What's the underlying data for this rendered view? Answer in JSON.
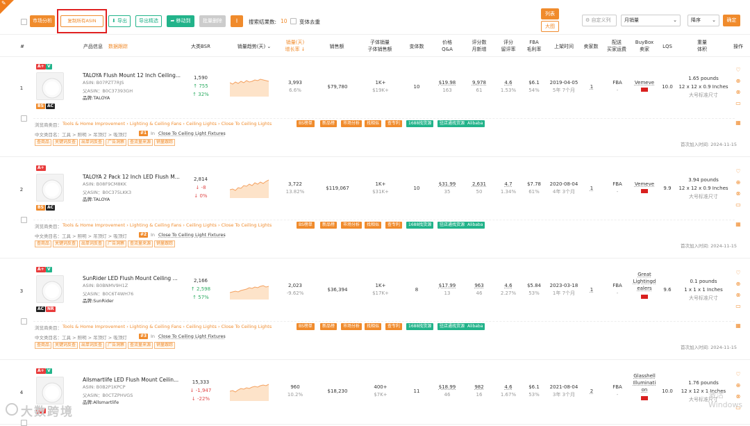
{
  "toolbar": {
    "market_btn": "市场分析",
    "copy_btn": "复制所有ASIN",
    "export_btn": "导出",
    "export_sel_btn": "导出精选",
    "move_btn": "移动到",
    "batch_del_btn": "批量删除",
    "more_btn": "⋮",
    "results_label": "搜索结果数:",
    "results_value": "10",
    "dedupe_label": "变体去重",
    "list_view_btn": "列表",
    "grid_view_btn": "大图",
    "custom_cols_btn": "自定义列",
    "sort_field": "月销量",
    "sort_order": "降序",
    "confirm_btn": "确定"
  },
  "header": {
    "col_num": "#",
    "col_product": "产品信息",
    "col_product_link": "数据跟踪",
    "col_bsr": "大类BSR",
    "col_trend": "销量趋势(天)",
    "col_sales_1": "销量(天)",
    "col_sales_2": "增长率",
    "col_revenue": "销售额",
    "col_child_1": "子体销量",
    "col_child_2": "子体销售额",
    "col_variants": "变体数",
    "col_price_1": "价格",
    "col_price_2": "Q&A",
    "col_reviews_1": "评分数",
    "col_reviews_2": "月新增",
    "col_rating_1": "评分",
    "col_rating_2": "留评率",
    "col_fba_1": "FBA",
    "col_fba_2": "毛利率",
    "col_listed": "上架时间",
    "col_sellers": "卖家数",
    "col_ship_1": "配送",
    "col_ship_2": "买家运费",
    "col_buybox_1": "BuyBox",
    "col_buybox_2": "卖家",
    "col_lqs": "LQS",
    "col_weight_1": "重量",
    "col_weight_2": "体积",
    "col_ops": "操作"
  },
  "rows": [
    {
      "index": "1",
      "title": "TALOYA Flush Mount 12 Inch Ceiling...",
      "asin": "ASIN: B07PZT7RJS",
      "parent": "父ASIN：B0C37393GH",
      "brand": "品牌:TALOYA",
      "badges_top": [
        "A+",
        "V"
      ],
      "badges_bottom": [
        "BS",
        "AC"
      ],
      "bsr": "1,590",
      "bsr_change": "↑ 755",
      "bsr_pct": "↑ 32%",
      "bsr_dir": "up",
      "sales": "3,993",
      "growth": "6.6%",
      "revenue": "$79,780",
      "child_sales": "1K+",
      "child_revenue": "$19K+",
      "variants": "10",
      "price": "$19.98",
      "qa": "163",
      "reviews": "9,978",
      "new_reviews": "61",
      "rating": "4.6",
      "review_rate": "1.53%",
      "fba": "$6.1",
      "margin": "54%",
      "listed": "2019-04-05",
      "age": "5年 7个月",
      "sellers": "1",
      "ship": "FBA",
      "ship_fee": "-",
      "buybox": "Vemeve",
      "lqs": "10.0",
      "weight": "1.65 pounds",
      "size": "12 x 12 x 0.9 Inches",
      "size_tier": "大号标准尺寸",
      "category": "浏览商类目：",
      "category_path": "Tools & Home Improvement › Lighting & Ceiling Fans › Ceiling Lights › Close To Ceiling Lights",
      "cn_path": "中文类目名：工具 > 照明 > 吊顶灯 > 吸顶灯",
      "rank_in": "In",
      "rank_cat": "Close To Ceiling Light Fixtures",
      "added": "首次加入时间:  2024-11-15"
    },
    {
      "index": "2",
      "title": "TALOYA 2 Pack 12 Inch LED Flush M...",
      "asin": "ASIN: B08F9CM8KK",
      "parent": "父ASIN：B0C375LKK3",
      "brand": "品牌:TALOYA",
      "badges_top": [
        "A+"
      ],
      "badges_bottom": [
        "BS",
        "AC"
      ],
      "bsr": "2,814",
      "bsr_change": "↓ -8",
      "bsr_pct": "↓ 0%",
      "bsr_dir": "dn",
      "sales": "3,722",
      "growth": "13.82%",
      "revenue": "$119,067",
      "child_sales": "1K+",
      "child_revenue": "$31K+",
      "variants": "10",
      "price": "$31.99",
      "qa": "35",
      "reviews": "2,631",
      "new_reviews": "50",
      "rating": "4.7",
      "review_rate": "1.34%",
      "fba": "$7.78",
      "margin": "61%",
      "listed": "2020-08-04",
      "age": "4年 3个月",
      "sellers": "1",
      "ship": "FBA",
      "ship_fee": "-",
      "buybox": "Vemeve",
      "lqs": "9.9",
      "weight": "3.94 pounds",
      "size": "12 x 12 x 0.9 Inches",
      "size_tier": "大号标准尺寸",
      "category": "浏览商类目：",
      "category_path": "Tools & Home Improvement › Lighting & Ceiling Fans › Ceiling Lights › Close To Ceiling Lights",
      "cn_path": "中文类目名：工具 > 照明 > 吊顶灯 > 吸顶灯",
      "rank_in": "In",
      "rank_cat": "Close To Ceiling Light Fixtures",
      "added": "首次加入时间:  2024-11-15"
    },
    {
      "index": "3",
      "title": "SunRider LED Flush Mount Ceiling ...",
      "asin": "ASIN: B0BNMV9H1Z",
      "parent": "父ASIN：B0C6T4WH76",
      "brand": "品牌:SunRider",
      "badges_top": [
        "A+",
        "V"
      ],
      "badges_bottom": [
        "AC",
        "NR"
      ],
      "bsr": "2,166",
      "bsr_change": "↑ 2,598",
      "bsr_pct": "↑ 57%",
      "bsr_dir": "up",
      "sales": "2,023",
      "growth": "-9.62%",
      "revenue": "$36,394",
      "child_sales": "1K+",
      "child_revenue": "$17K+",
      "variants": "8",
      "price": "$17.99",
      "qa": "13",
      "reviews": "963",
      "new_reviews": "46",
      "rating": "4.6",
      "review_rate": "2.27%",
      "fba": "$5.84",
      "margin": "53%",
      "listed": "2023-03-18",
      "age": "1年 7个月",
      "sellers": "1",
      "ship": "FBA",
      "ship_fee": "-",
      "buybox": "Great Lightingd ealers",
      "lqs": "9.6",
      "weight": "0.1 pounds",
      "size": "1 x 1 x 1 Inches",
      "size_tier": "大号标准尺寸",
      "category": "浏览商类目：",
      "category_path": "Tools & Home Improvement › Lighting & Ceiling Fans › Ceiling Lights › Close To Ceiling Lights",
      "cn_path": "中文类目名：工具 > 照明 > 吊顶灯 > 吸顶灯",
      "rank_in": "In",
      "rank_cat": "Close To Ceiling Light Fixtures",
      "added": "首次加入时间:  2024-11-15"
    },
    {
      "index": "4",
      "title": "Allsmartlife LED Flush Mount Ceilin...",
      "asin": "ASIN: B0B2P1KPCP",
      "parent": "父ASIN：B0CTZPHVGS",
      "brand": "品牌:Allsmartlife",
      "badges_top": [
        "A+",
        "V"
      ],
      "badges_bottom": [
        "NR"
      ],
      "bsr": "15,333",
      "bsr_change": "↓ -1,947",
      "bsr_pct": "↓ -22%",
      "bsr_dir": "dn",
      "sales": "960",
      "growth": "10.2%",
      "revenue": "$18,230",
      "child_sales": "400+",
      "child_revenue": "$7K+",
      "variants": "11",
      "price": "$18.99",
      "qa": "46",
      "reviews": "982",
      "new_reviews": "16",
      "rating": "4.6",
      "review_rate": "1.67%",
      "fba": "$6.1",
      "margin": "53%",
      "listed": "2021-08-04",
      "age": "3年 3个月",
      "sellers": "2",
      "ship": "FBA",
      "ship_fee": "-",
      "buybox": "Glasshell Illuminati on",
      "lqs": "10.0",
      "weight": "1.76 pounds",
      "size": "12 x 12 x 1 Inches",
      "size_tier": "大号标准尺寸"
    }
  ],
  "tags_orange": [
    "BS榜单",
    "新品榜",
    "市场分析",
    "找相似",
    "查专利"
  ],
  "tags_green": [
    "1688找货源",
    "驻店通找货源",
    "Alibaba"
  ],
  "tags_outline": [
    "查商品",
    "关键词反查",
    "出单词反查",
    "广告洞察",
    "查流量来源",
    "销量跟踪"
  ],
  "watermark": "大数跨境",
  "os_watermark": "激活 Windows"
}
